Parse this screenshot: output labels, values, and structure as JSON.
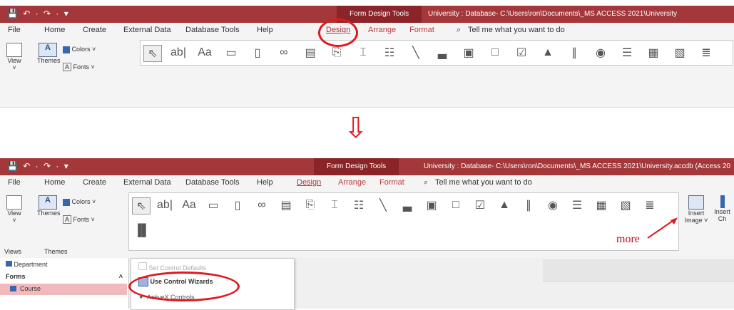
{
  "title_bar": {
    "qat": "💾 ↶ · ↷ · ▾",
    "context_tab": "Form Design Tools",
    "path_top": "University : Database- C:\\Users\\ron\\Documents\\_MS ACCESS 2021\\University",
    "path_bottom": "University : Database- C:\\Users\\ron\\Documents\\_MS ACCESS 2021\\University.accdb (Access 20"
  },
  "menu": {
    "file": "File",
    "home": "Home",
    "create": "Create",
    "external_data": "External Data",
    "database_tools": "Database Tools",
    "help": "Help",
    "design": "Design",
    "arrange": "Arrange",
    "format": "Format",
    "tell_me": "Tell me what you want to do"
  },
  "ribbon": {
    "view": "View",
    "themes": "Themes",
    "colors": "Colors ˅",
    "fonts": "Fonts ˅",
    "views_group": "Views",
    "themes_group": "Themes",
    "insert_image": "Insert Image ˅",
    "insert_chart": "Insert Ch"
  },
  "controls": [
    "⇖",
    "ab|",
    "Aa",
    "▭",
    "▯",
    "∞",
    "▤",
    "⎘",
    "⌶",
    "☷",
    "╲",
    "▃",
    "▣",
    "□",
    "☑",
    "▲",
    "∥",
    "◉",
    "☰",
    "▦",
    "▧",
    "≣"
  ],
  "arrow_down": "⇩",
  "annotation": {
    "more": "more"
  },
  "nav_pane": {
    "department": "Department",
    "forms_header": "Forms",
    "forms_chevron": "˄",
    "course": "Course"
  },
  "context_menu": {
    "set_control_defaults": "Set Control Defaults",
    "use_control_wizards": "Use Control Wizards",
    "activex_controls": "ActiveX Controls"
  },
  "colors": {
    "accent": "#a4373a",
    "highlight_red": "#e0191f"
  }
}
